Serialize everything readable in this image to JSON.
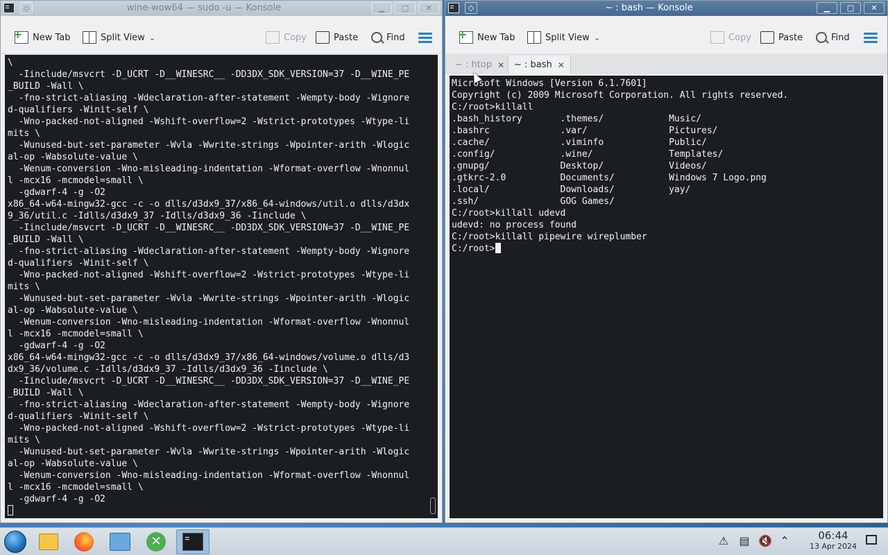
{
  "left_window": {
    "title": "wine-wow64 — sudo -u — Konsole",
    "toolbar": {
      "new_tab": "New Tab",
      "split_view": "Split View",
      "copy": "Copy",
      "paste": "Paste",
      "find": "Find"
    },
    "lines": [
      "\\",
      "  -Iinclude/msvcrt -D_UCRT -D__WINESRC__ -DD3DX_SDK_VERSION=37 -D__WINE_PE",
      "_BUILD -Wall \\",
      "  -fno-strict-aliasing -Wdeclaration-after-statement -Wempty-body -Wignore",
      "d-qualifiers -Winit-self \\",
      "  -Wno-packed-not-aligned -Wshift-overflow=2 -Wstrict-prototypes -Wtype-li",
      "mits \\",
      "  -Wunused-but-set-parameter -Wvla -Wwrite-strings -Wpointer-arith -Wlogic",
      "al-op -Wabsolute-value \\",
      "  -Wenum-conversion -Wno-misleading-indentation -Wformat-overflow -Wnonnul",
      "l -mcx16 -mcmodel=small \\",
      "  -gdwarf-4 -g -O2",
      "x86_64-w64-mingw32-gcc -c -o dlls/d3dx9_37/x86_64-windows/util.o dlls/d3dx",
      "9_36/util.c -Idlls/d3dx9_37 -Idlls/d3dx9_36 -Iinclude \\",
      "  -Iinclude/msvcrt -D_UCRT -D__WINESRC__ -DD3DX_SDK_VERSION=37 -D__WINE_PE",
      "_BUILD -Wall \\",
      "  -fno-strict-aliasing -Wdeclaration-after-statement -Wempty-body -Wignore",
      "d-qualifiers -Winit-self \\",
      "  -Wno-packed-not-aligned -Wshift-overflow=2 -Wstrict-prototypes -Wtype-li",
      "mits \\",
      "  -Wunused-but-set-parameter -Wvla -Wwrite-strings -Wpointer-arith -Wlogic",
      "al-op -Wabsolute-value \\",
      "  -Wenum-conversion -Wno-misleading-indentation -Wformat-overflow -Wnonnul",
      "l -mcx16 -mcmodel=small \\",
      "  -gdwarf-4 -g -O2",
      "x86_64-w64-mingw32-gcc -c -o dlls/d3dx9_37/x86_64-windows/volume.o dlls/d3",
      "dx9_36/volume.c -Idlls/d3dx9_37 -Idlls/d3dx9_36 -Iinclude \\",
      "  -Iinclude/msvcrt -D_UCRT -D__WINESRC__ -DD3DX_SDK_VERSION=37 -D__WINE_PE",
      "_BUILD -Wall \\",
      "  -fno-strict-aliasing -Wdeclaration-after-statement -Wempty-body -Wignore",
      "d-qualifiers -Winit-self \\",
      "  -Wno-packed-not-aligned -Wshift-overflow=2 -Wstrict-prototypes -Wtype-li",
      "mits \\",
      "  -Wunused-but-set-parameter -Wvla -Wwrite-strings -Wpointer-arith -Wlogic",
      "al-op -Wabsolute-value \\",
      "  -Wenum-conversion -Wno-misleading-indentation -Wformat-overflow -Wnonnul",
      "l -mcx16 -mcmodel=small \\",
      "  -gdwarf-4 -g -O2"
    ]
  },
  "right_window": {
    "title": "~ : bash — Konsole",
    "toolbar": {
      "new_tab": "New Tab",
      "split_view": "Split View",
      "copy": "Copy",
      "paste": "Paste",
      "find": "Find"
    },
    "tabs": [
      {
        "label": "~ : htop"
      },
      {
        "label": "~ : bash"
      }
    ],
    "lines": [
      "Microsoft Windows [Version 6.1.7601]",
      "Copyright (c) 2009 Microsoft Corporation. All rights reserved.",
      "",
      "C:/root>killall",
      ".bash_history       .themes/            Music/",
      ".bashrc             .var/               Pictures/",
      ".cache/             .viminfo            Public/",
      ".config/            .wine/              Templates/",
      ".gnupg/             Desktop/            Videos/",
      ".gtkrc-2.0          Documents/          Windows 7 Logo.png",
      ".local/             Downloads/          yay/",
      ".ssh/               GOG Games/",
      "C:/root>killall udevd",
      "udevd: no process found",
      "C:/root>killall pipewire wireplumber"
    ],
    "prompt": "C:/root>"
  },
  "taskbar": {
    "time": "06:44",
    "date": "13 Apr 2024",
    "tools_icon_glyph": "✕",
    "tray_glyphs": {
      "alerts": "⚠",
      "clipboard": "▤",
      "volume": "🔇",
      "expand": "⌃"
    },
    "window_glyphs": {
      "pin": "◇",
      "minimize": "▁",
      "maximize": "□",
      "close": "✕",
      "tab_close": "✕",
      "dropdown": "⌄"
    }
  },
  "icons": {
    "left": [
      "konsole-icon",
      "pin-icon",
      "new-tab-icon",
      "split-view-icon",
      "copy-icon",
      "paste-icon",
      "find-icon",
      "hamburger-menu-icon"
    ],
    "taskbar": [
      "start-menu-icon",
      "files-icon",
      "firefox-icon",
      "system-settings-icon",
      "tools-icon",
      "konsole-icon",
      "alert-icon",
      "clipboard-icon",
      "volume-muted-icon",
      "chevron-up-icon",
      "show-desktop-icon"
    ]
  }
}
